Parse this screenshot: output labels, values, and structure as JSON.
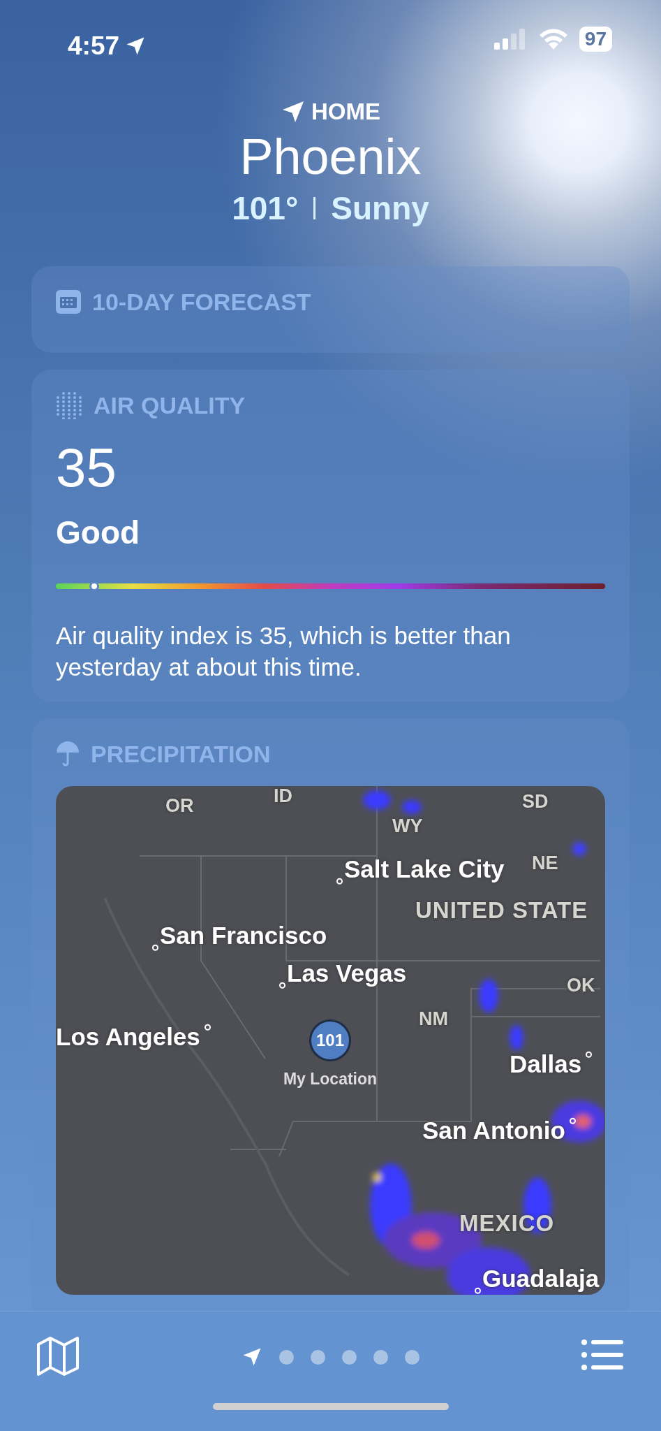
{
  "status_bar": {
    "time": "4:57",
    "battery": "97"
  },
  "header": {
    "label": "HOME",
    "city": "Phoenix",
    "temperature": "101°",
    "condition": "Sunny"
  },
  "forecast_card": {
    "title": "10-DAY FORECAST"
  },
  "air_quality": {
    "title": "AIR QUALITY",
    "value": "35",
    "category": "Good",
    "level": 0.07,
    "description": "Air quality index is 35, which is better than yesterday at about this time."
  },
  "precipitation": {
    "title": "PRECIPITATION",
    "map": {
      "labels": [
        {
          "text": "OR",
          "kind": "region"
        },
        {
          "text": "ID",
          "kind": "region"
        },
        {
          "text": "SD",
          "kind": "region"
        },
        {
          "text": "WY",
          "kind": "region"
        },
        {
          "text": "Salt Lake City",
          "kind": "city"
        },
        {
          "text": "NE",
          "kind": "region"
        },
        {
          "text": "UNITED STATE",
          "kind": "country"
        },
        {
          "text": "San Francisco",
          "kind": "city"
        },
        {
          "text": "Las Vegas",
          "kind": "city"
        },
        {
          "text": "OK",
          "kind": "region"
        },
        {
          "text": "NM",
          "kind": "region"
        },
        {
          "text": "Los Angeles",
          "kind": "city_left"
        },
        {
          "text": "Dallas",
          "kind": "city_left"
        },
        {
          "text": "San Antonio",
          "kind": "city_left"
        },
        {
          "text": "MEXICO",
          "kind": "country"
        },
        {
          "text": "Guadalaja",
          "kind": "city"
        }
      ],
      "pin": {
        "temperature": "101",
        "label": "My Location"
      }
    }
  },
  "pages": [
    {
      "kind": "location",
      "selected": true
    },
    {
      "kind": "dot",
      "selected": false
    },
    {
      "kind": "dot",
      "selected": false
    },
    {
      "kind": "dot",
      "selected": false
    },
    {
      "kind": "dot",
      "selected": false
    },
    {
      "kind": "dot",
      "selected": false
    }
  ]
}
